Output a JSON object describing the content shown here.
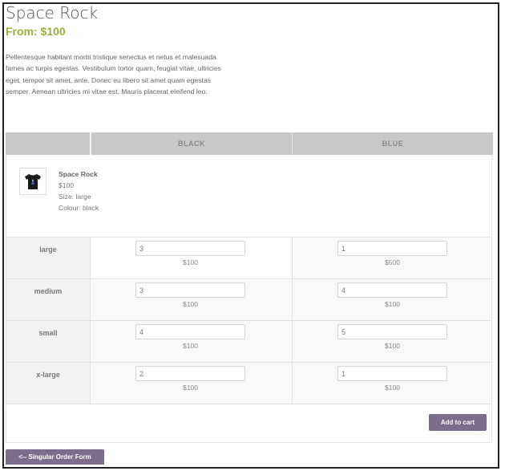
{
  "product": {
    "title": "Space Rock",
    "from_price": "From: $100",
    "description": "Pellentesque habitant morbi tristique senectus et netus et malesuada fames ac turpis egestas. Vestibulum tortor quam, feugiat vitae, ultricies eget, tempor sit amet, ante. Donec eu libero sit amet quam egestas semper. Aenean ultricies mi vitae est. Mauris placerat eleifend leo."
  },
  "grid": {
    "headers": {
      "corner": "",
      "black": "BLACK",
      "blue": "BLUE"
    },
    "selected": {
      "name": "Space Rock",
      "price": "$100",
      "size": "Size: large",
      "colour": "Colour: black"
    },
    "rows": [
      {
        "size": "large",
        "black_qty": "3",
        "black_price": "$100",
        "blue_qty": "1",
        "blue_price": "$500"
      },
      {
        "size": "medium",
        "black_qty": "3",
        "black_price": "$100",
        "blue_qty": "4",
        "blue_price": "$100"
      },
      {
        "size": "small",
        "black_qty": "4",
        "black_price": "$100",
        "blue_qty": "5",
        "blue_price": "$100"
      },
      {
        "size": "x-large",
        "black_qty": "2",
        "black_price": "$100",
        "blue_qty": "1",
        "blue_price": "$100"
      }
    ]
  },
  "actions": {
    "add_to_cart": "Add to cart",
    "back": "<-- Singular Order Form"
  },
  "colors": {
    "accent_green": "#98b13d",
    "button_purple": "#7b6e8c",
    "header_gray": "#c8c8c8"
  },
  "icons": {
    "thumbnail": "tshirt-thumbnail-icon"
  }
}
